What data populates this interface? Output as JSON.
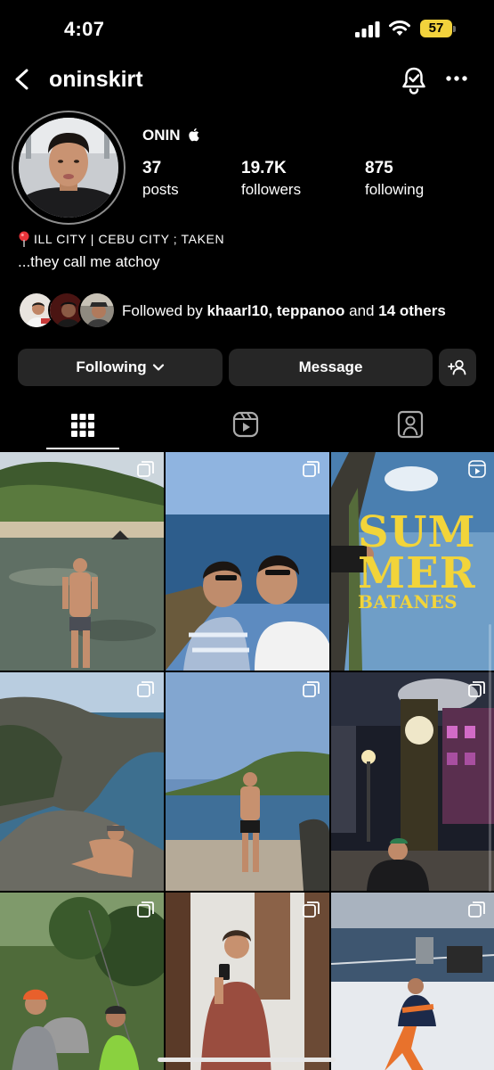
{
  "status_bar": {
    "time": "4:07",
    "battery_level": "57",
    "battery_color": "#f2d23c"
  },
  "header": {
    "username": "oninskirt"
  },
  "profile": {
    "display_name": "ONIN",
    "stats": [
      {
        "value": "37",
        "label": "posts"
      },
      {
        "value": "19.7K",
        "label": "followers"
      },
      {
        "value": "875",
        "label": "following"
      }
    ],
    "bio_line1": "ILL CITY | CEBU CITY ; TAKEN",
    "bio_line2": "...they call me atchoy",
    "followed_by": {
      "prefix": "Followed by",
      "names": "khaarl10, teppanoo",
      "connector": "and",
      "others": "14 others"
    }
  },
  "actions": {
    "following_label": "Following",
    "message_label": "Message"
  },
  "tabs": [
    {
      "icon": "grid-icon",
      "active": true
    },
    {
      "icon": "reels-icon",
      "active": false
    },
    {
      "icon": "tagged-icon",
      "active": false
    }
  ],
  "grid": {
    "posts": [
      {
        "type": "carousel",
        "subject": "beach-rocks"
      },
      {
        "type": "carousel",
        "subject": "couple-kiss"
      },
      {
        "type": "reel",
        "subject": "summer-batanes",
        "overlay_text": [
          "SUM",
          "MER",
          "BATANES"
        ]
      },
      {
        "type": "carousel",
        "subject": "cliff-ocean"
      },
      {
        "type": "carousel",
        "subject": "beach-standing"
      },
      {
        "type": "carousel",
        "subject": "steam-clock"
      },
      {
        "type": "carousel",
        "subject": "zipline-helmet"
      },
      {
        "type": "carousel",
        "subject": "mirror-selfie"
      },
      {
        "type": "carousel",
        "subject": "snow-ship"
      }
    ]
  },
  "colors": {
    "background": "#000000",
    "button_bg": "#262626",
    "text": "#ffffff",
    "overlay_yellow": "#f2d43a"
  }
}
